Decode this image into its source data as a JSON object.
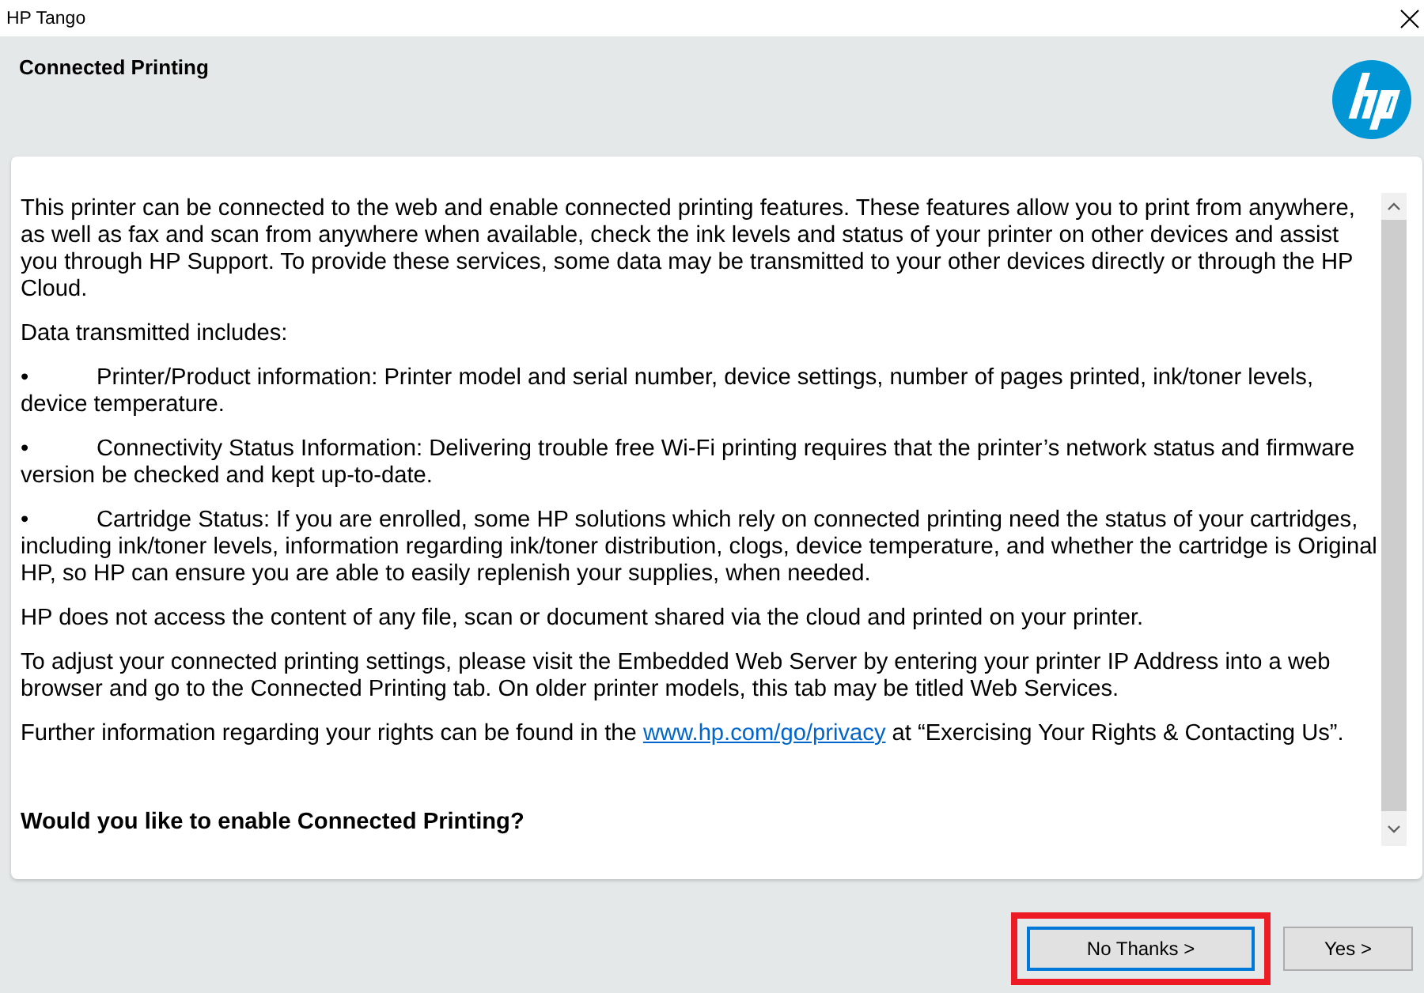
{
  "window": {
    "title": "HP Tango"
  },
  "header": {
    "title": "Connected Printing"
  },
  "content": {
    "paragraphs": [
      {
        "kind": "text",
        "text": "This printer can be connected to the web and enable connected printing features. These features allow you to print from anywhere, as well as fax and scan from anywhere when available, check the ink levels and status of your printer on other devices and assist you through HP Support. To provide these services, some data may be transmitted to your other devices directly or through the HP Cloud."
      },
      {
        "kind": "text",
        "text": "Data transmitted includes:"
      },
      {
        "kind": "bullet",
        "bullet": "•",
        "text": "Printer/Product information: Printer model and serial number, device settings, number of pages printed, ink/toner levels, device temperature."
      },
      {
        "kind": "bullet",
        "bullet": "•",
        "text": "Connectivity Status Information: Delivering trouble free Wi-Fi printing requires that the printer’s network status and firmware version be checked and kept up-to-date."
      },
      {
        "kind": "bullet",
        "bullet": "•",
        "text": "Cartridge Status: If you are enrolled, some HP solutions which rely on connected printing need the status of your cartridges, including ink/toner levels, information regarding ink/toner distribution, clogs, device temperature, and whether the cartridge is Original HP, so HP can ensure you are able to easily replenish your supplies, when needed."
      },
      {
        "kind": "text",
        "text": "HP does not access the content of any file, scan or document shared via the cloud and printed on your printer."
      },
      {
        "kind": "text",
        "text": "To adjust your connected printing settings, please visit the Embedded Web Server by entering your printer IP Address into a web browser and go to the Connected Printing tab. On older printer models, this tab may be titled Web Services."
      },
      {
        "kind": "link",
        "before": "Further information regarding your rights can be found in the ",
        "link": "www.hp.com/go/privacy",
        "after": " at “Exercising Your Rights & Contacting Us”."
      }
    ],
    "question": "Would you like to enable Connected Printing?"
  },
  "buttons": [
    {
      "label": "No Thanks >",
      "focused": true,
      "highlighted": true
    },
    {
      "label": "Yes >",
      "focused": false,
      "highlighted": false
    }
  ]
}
